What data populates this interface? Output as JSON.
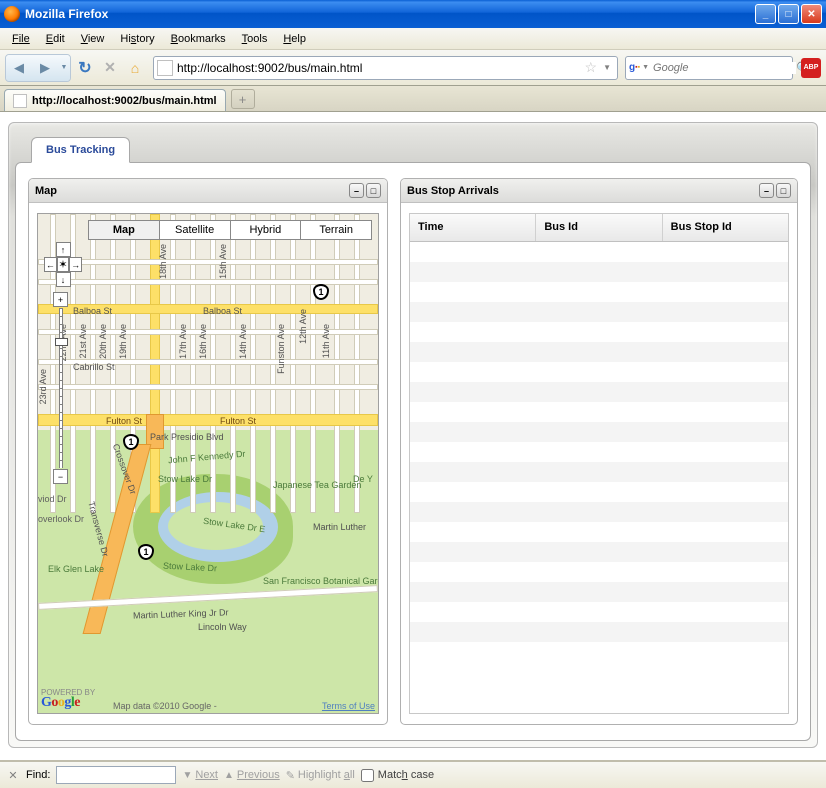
{
  "window": {
    "title": "Mozilla Firefox"
  },
  "menu": {
    "file": "File",
    "edit": "Edit",
    "view": "View",
    "history": "History",
    "bookmarks": "Bookmarks",
    "tools": "Tools",
    "help": "Help"
  },
  "toolbar": {
    "url": "http://localhost:9002/bus/main.html",
    "search_placeholder": "Google",
    "abp": "ABP"
  },
  "tabs": {
    "active": "http://localhost:9002/bus/main.html"
  },
  "app": {
    "tab": "Bus Tracking",
    "map": {
      "title": "Map",
      "types": {
        "map": "Map",
        "satellite": "Satellite",
        "hybrid": "Hybrid",
        "terrain": "Terrain"
      },
      "labels": {
        "balboa": "Balboa St",
        "cabrillo": "Cabrillo St",
        "fulton": "Fulton St",
        "fulton2": "Fulton St",
        "park_presidio": "Park Presidio Blvd",
        "jfk": "John F Kennedy Dr",
        "stow_a": "Stow Lake Dr",
        "stow_b": "Stow Lake Dr",
        "stow_c": "Stow Lake Dr E",
        "mlk": "Martin Luther King Jr Dr",
        "mlk2": "Martin Luther",
        "crossover": "Crossover Dr",
        "transverse": "Transverse Dr",
        "a11": "11th Ave",
        "a12": "12th Ave",
        "a14": "14th Ave",
        "a15": "15th Ave",
        "a16": "16th Ave",
        "a17": "17th Ave",
        "a18": "18th Ave",
        "a19": "19th Ave",
        "a20": "20th Ave",
        "a21": "21st Ave",
        "a22": "22nd Ave",
        "a23": "23rd Ave",
        "funston": "Funston Ave",
        "jtg": "Japanese Tea Garden",
        "sfbg": "San Francisco Botanical Garden",
        "egl": "Elk Glen Lake",
        "dey": "De Y",
        "viodr": "viod Dr",
        "overlook": "overlook Dr",
        "lincoln": "Lincoln Way",
        "route1": "1",
        "powered_by": "POWERED BY",
        "google": "Google",
        "copyright": "Map data ©2010  Google -",
        "terms": "Terms of Use"
      }
    },
    "arrivals": {
      "title": "Bus Stop Arrivals",
      "cols": {
        "time": "Time",
        "bus": "Bus Id",
        "stop": "Bus Stop Id"
      }
    }
  },
  "findbar": {
    "label": "Find:",
    "next": "Next",
    "previous": "Previous",
    "highlight": "Highlight all",
    "match": "Match case"
  }
}
